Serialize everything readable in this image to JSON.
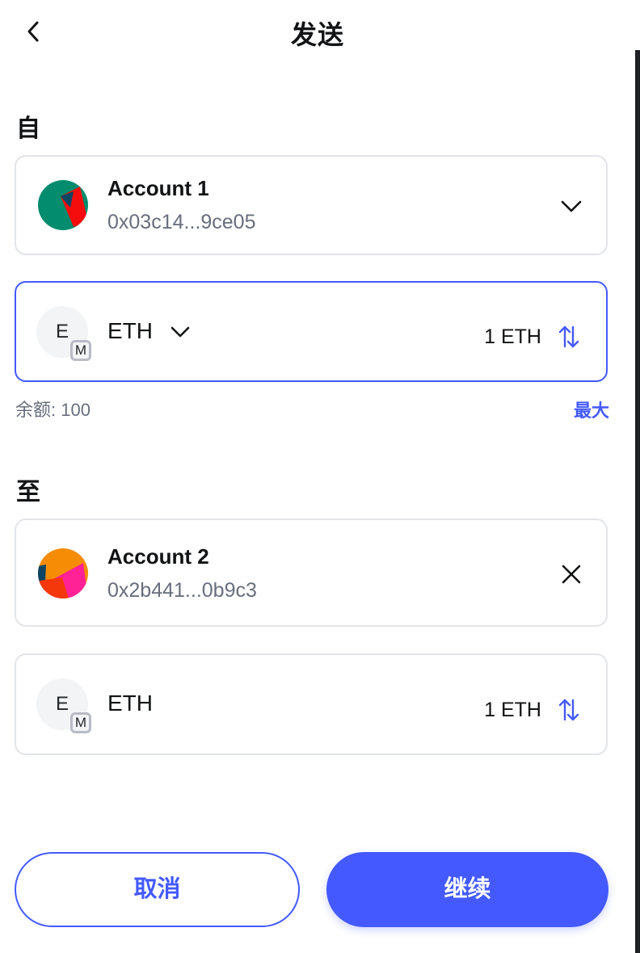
{
  "header": {
    "title": "发送"
  },
  "from": {
    "label": "自",
    "account": {
      "name": "Account 1",
      "address": "0x03c14...9ce05"
    },
    "asset": {
      "token_letter": "E",
      "network_letter": "M",
      "symbol": "ETH",
      "amount": "1 ETH"
    },
    "balance": "余额: 100",
    "max_label": "最大"
  },
  "to": {
    "label": "至",
    "account": {
      "name": "Account 2",
      "address": "0x2b441...0b9c3"
    },
    "asset": {
      "token_letter": "E",
      "network_letter": "M",
      "symbol": "ETH",
      "amount": "1 ETH"
    }
  },
  "footer": {
    "cancel_label": "取消",
    "continue_label": "继续"
  },
  "colors": {
    "accent": "#4459ff",
    "border": "#e2e4e8",
    "muted_text": "#686e7d",
    "avatar1": [
      "#048c6e",
      "#f50d0d",
      "#0b4563"
    ],
    "avatar2": [
      "#f58c04",
      "#ff2195",
      "#f5380b",
      "#0b4563"
    ]
  }
}
